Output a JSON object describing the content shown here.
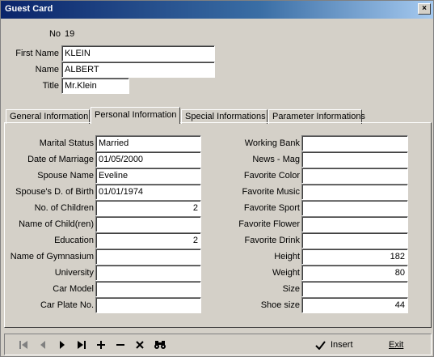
{
  "window": {
    "title": "Guest Card",
    "close_glyph": "×"
  },
  "header": {
    "no_label": "No",
    "no_value": "19",
    "first_name_label": "First Name",
    "first_name_value": "KLEIN",
    "name_label": "Name",
    "name_value": "ALBERT",
    "title_label": "Title",
    "title_value": "Mr.Klein"
  },
  "tabs": [
    {
      "label": "General Information",
      "active": false
    },
    {
      "label": "Personal Information",
      "active": true
    },
    {
      "label": "Special Informations",
      "active": false
    },
    {
      "label": "Parameter Informations",
      "active": false
    }
  ],
  "personal": {
    "left": [
      {
        "label": "Marital Status",
        "value": "Married"
      },
      {
        "label": "Date of Marriage",
        "value": "01/05/2000"
      },
      {
        "label": "Spouse Name",
        "value": "Eveline"
      },
      {
        "label": "Spouse's D. of Birth",
        "value": "01/01/1974"
      },
      {
        "label": "No. of Children",
        "value": "2"
      },
      {
        "label": "Name of Child(ren)",
        "value": ""
      },
      {
        "label": "Education",
        "value": "2"
      },
      {
        "label": "Name of Gymnasium",
        "value": ""
      },
      {
        "label": "University",
        "value": ""
      },
      {
        "label": "Car Model",
        "value": ""
      },
      {
        "label": "Car Plate No.",
        "value": ""
      }
    ],
    "right": [
      {
        "label": "Working Bank",
        "value": ""
      },
      {
        "label": "News - Mag",
        "value": ""
      },
      {
        "label": "Favorite Color",
        "value": ""
      },
      {
        "label": "Favorite Music",
        "value": ""
      },
      {
        "label": "Favorite Sport",
        "value": ""
      },
      {
        "label": "Favorite Flower",
        "value": ""
      },
      {
        "label": "Favorite Drink",
        "value": ""
      },
      {
        "label": "Height",
        "value": "182"
      },
      {
        "label": "Weight",
        "value": "80"
      },
      {
        "label": "Size",
        "value": ""
      },
      {
        "label": "Shoe size",
        "value": "44"
      }
    ]
  },
  "toolbar": {
    "insert_label": "Insert",
    "exit_label": "Exit",
    "icons": [
      "first-record-icon",
      "prior-record-icon",
      "next-record-icon",
      "last-record-icon",
      "plus-icon",
      "minus-icon",
      "cancel-icon",
      "binoculars-icon",
      "checkmark-icon"
    ]
  },
  "colors": {
    "titlebar_start": "#0a246a",
    "titlebar_end": "#a6caf0",
    "face": "#d4d0c8"
  }
}
